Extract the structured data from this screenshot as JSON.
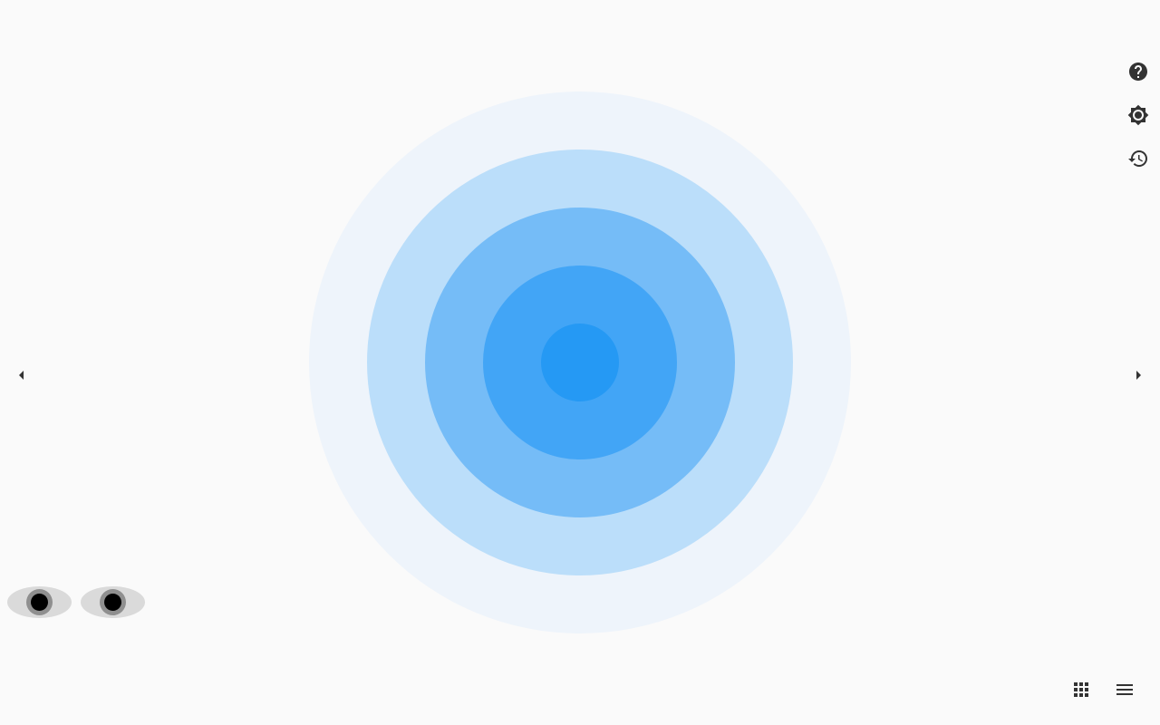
{
  "target": {
    "rings": [
      {
        "name": "outer",
        "color": "#eef4fb"
      },
      {
        "name": "second",
        "color": "#bbdefa"
      },
      {
        "name": "third",
        "color": "#75bcf7"
      },
      {
        "name": "fourth",
        "color": "#42a5f6"
      },
      {
        "name": "center",
        "color": "#2599f4"
      }
    ]
  },
  "toolbar": {
    "icons": [
      "help-icon",
      "brightness-icon",
      "history-icon"
    ],
    "icon_color": "#333333"
  },
  "navigation": {
    "prev_icon": "arrow-left-icon",
    "next_icon": "arrow-right-icon"
  },
  "bottom_bar": {
    "icons": [
      "apps-grid-icon",
      "menu-icon"
    ]
  },
  "eyes": {
    "sclera_color": "#dadada",
    "iris_color": "#8f8f8f",
    "pupil_color": "#000000"
  },
  "colors": {
    "background": "#fafafa"
  }
}
